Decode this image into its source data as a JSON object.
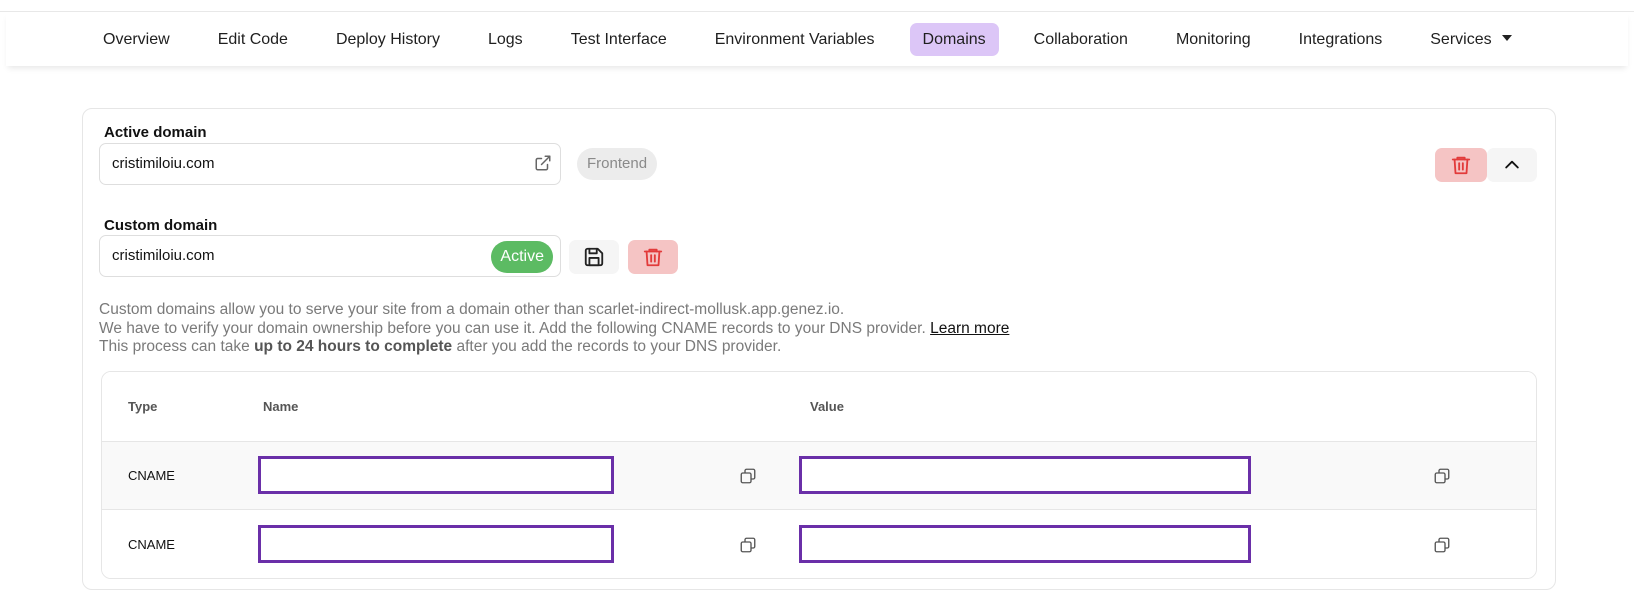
{
  "nav": {
    "tabs": [
      {
        "label": "Overview"
      },
      {
        "label": "Edit Code"
      },
      {
        "label": "Deploy History"
      },
      {
        "label": "Logs"
      },
      {
        "label": "Test Interface"
      },
      {
        "label": "Environment Variables"
      },
      {
        "label": "Domains",
        "active": true
      },
      {
        "label": "Collaboration"
      },
      {
        "label": "Monitoring"
      },
      {
        "label": "Integrations"
      },
      {
        "label": "Services"
      }
    ],
    "accent_color": "#dcc6f7"
  },
  "active_domain": {
    "label": "Active domain",
    "value": "cristimiloiu.com",
    "badge": "Frontend"
  },
  "custom_domain": {
    "label": "Custom domain",
    "value": "cristimiloiu.com",
    "status": "Active",
    "status_color": "#5cbb63"
  },
  "help": {
    "line1": "Custom domains allow you to serve your site from a domain other than scarlet-indirect-mollusk.app.genez.io.",
    "line2": "We have to verify your domain ownership before you can use it. Add the following CNAME records to your DNS provider.",
    "learn_more": "Learn more",
    "line3_pre": "This process can take ",
    "line3_bold": "up to 24 hours to complete",
    "line3_post": " after you add the records to your DNS provider."
  },
  "records": {
    "headers": {
      "type": "Type",
      "name": "Name",
      "value": "Value"
    },
    "rows": [
      {
        "type": "CNAME"
      },
      {
        "type": "CNAME"
      }
    ],
    "redaction_color": "#6a2fa8"
  }
}
